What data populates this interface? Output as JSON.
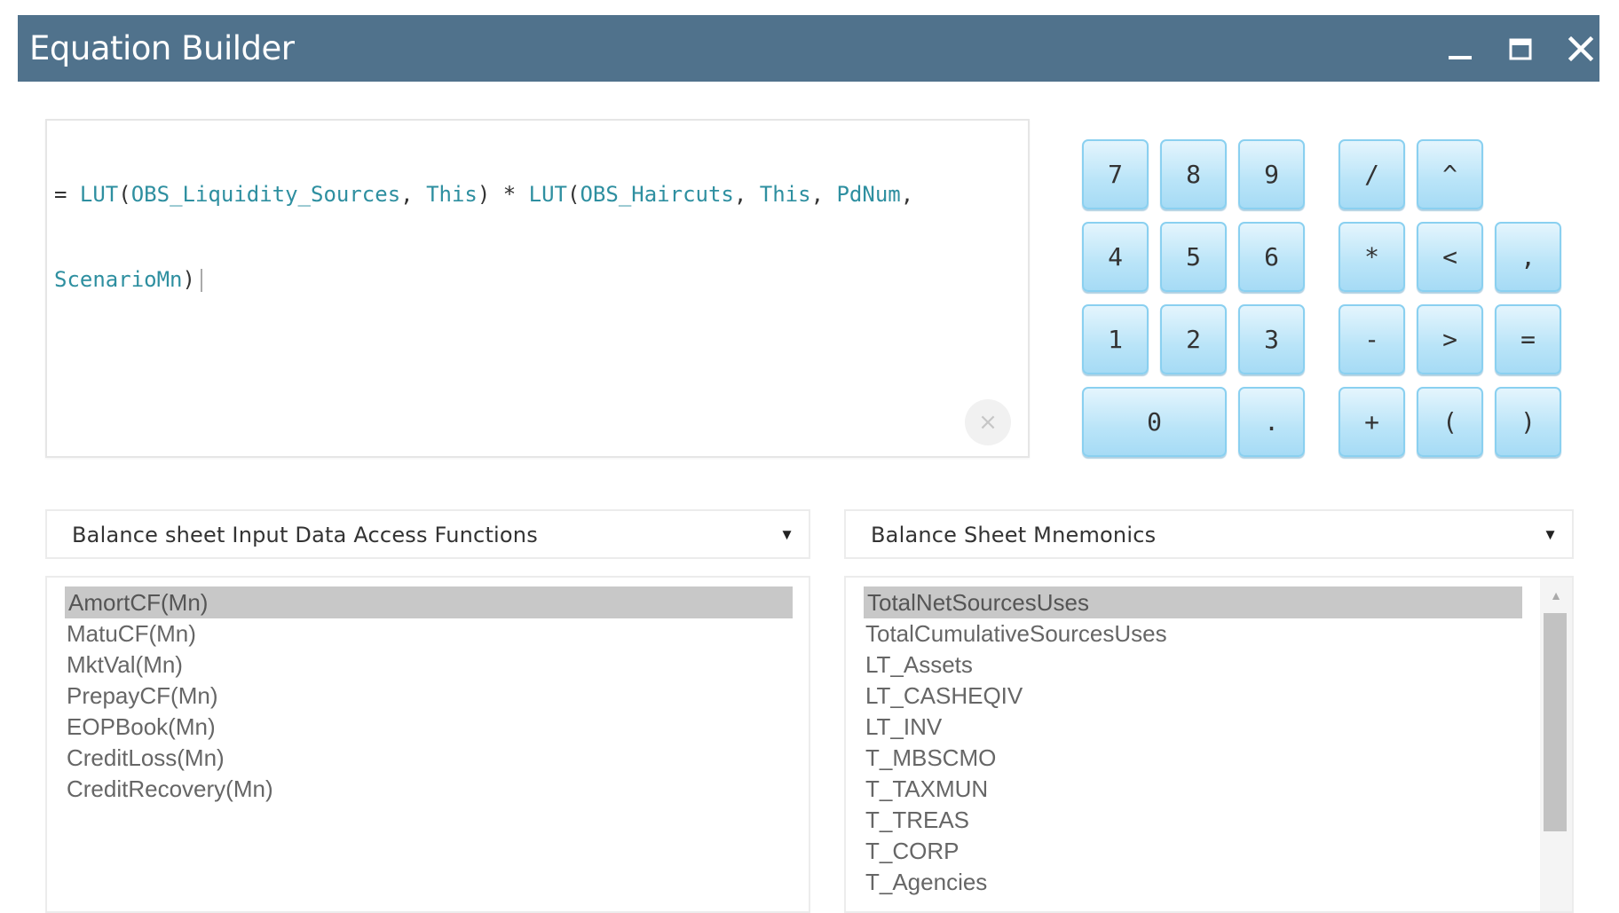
{
  "window": {
    "title": "Equation Builder",
    "controls": {
      "minimize": "minimize",
      "maximize": "maximize",
      "close": "close"
    }
  },
  "editor": {
    "line1": [
      {
        "t": "= ",
        "c": "op"
      },
      {
        "t": "LUT",
        "c": "fn"
      },
      {
        "t": "(",
        "c": "op"
      },
      {
        "t": "OBS_Liquidity_Sources",
        "c": "id"
      },
      {
        "t": ", ",
        "c": "op"
      },
      {
        "t": "This",
        "c": "id"
      },
      {
        "t": ") * ",
        "c": "op"
      },
      {
        "t": "LUT",
        "c": "fn"
      },
      {
        "t": "(",
        "c": "op"
      },
      {
        "t": "OBS_Haircuts",
        "c": "id"
      },
      {
        "t": ", ",
        "c": "op"
      },
      {
        "t": "This",
        "c": "id"
      },
      {
        "t": ", ",
        "c": "op"
      },
      {
        "t": "PdNum",
        "c": "id"
      },
      {
        "t": ",",
        "c": "op"
      }
    ],
    "line2": [
      {
        "t": "ScenarioMn",
        "c": "id"
      },
      {
        "t": ")",
        "c": "op"
      }
    ],
    "clear_label": "×"
  },
  "keypad": {
    "k7": "7",
    "k8": "8",
    "k9": "9",
    "kdiv": "/",
    "kpow": "^",
    "k4": "4",
    "k5": "5",
    "k6": "6",
    "kmul": "*",
    "klt": "<",
    "kcomma": ",",
    "k1": "1",
    "k2": "2",
    "k3": "3",
    "kminus": "-",
    "kgt": ">",
    "keq": "=",
    "k0": "0",
    "kdot": ".",
    "kplus": "+",
    "klparen": "(",
    "krparen": ")"
  },
  "functions": {
    "dropdown_label": "Balance sheet Input Data Access Functions",
    "items": [
      "AmortCF(Mn)",
      "MatuCF(Mn)",
      "MktVal(Mn)",
      "PrepayCF(Mn)",
      "EOPBook(Mn)",
      "CreditLoss(Mn)",
      "CreditRecovery(Mn)"
    ],
    "selected_index": 0
  },
  "mnemonics": {
    "dropdown_label": "Balance Sheet Mnemonics",
    "items": [
      "TotalNetSourcesUses",
      "TotalCumulativeSourcesUses",
      "LT_Assets",
      "LT_CASHEQIV",
      "LT_INV",
      "T_MBSCMO",
      "T_TAXMUN",
      "T_TREAS",
      "T_CORP",
      "T_Agencies"
    ],
    "selected_index": 0
  },
  "dropdown_arrow": "▼",
  "scroll_up_arrow": "▲"
}
